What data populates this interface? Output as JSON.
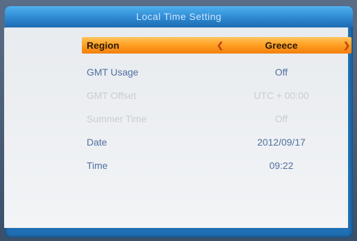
{
  "title": "Local Time Setting",
  "sidebar": {
    "items": [
      {
        "icon": "play-icon"
      },
      {
        "icon": "tv-icon"
      },
      {
        "icon": "disc-icon"
      },
      {
        "icon": "settings-gear-icon"
      },
      {
        "icon": "toolbox-icon"
      }
    ]
  },
  "settings": [
    {
      "label": "Region",
      "value": "Greece",
      "state": "selected"
    },
    {
      "label": "GMT Usage",
      "value": "Off",
      "state": "active"
    },
    {
      "label": "GMT Offset",
      "value": "UTC + 00:00",
      "state": "disabled"
    },
    {
      "label": "Summer Time",
      "value": "Off",
      "state": "disabled"
    },
    {
      "label": "Date",
      "value": "2012/09/17",
      "state": "active"
    },
    {
      "label": "Time",
      "value": "09:22",
      "state": "active"
    }
  ],
  "colors": {
    "title_bar": "#2f8ad2",
    "highlight": "#ff9e21",
    "active_text": "#4f6fa0",
    "disabled_text": "#c8ccd3"
  }
}
